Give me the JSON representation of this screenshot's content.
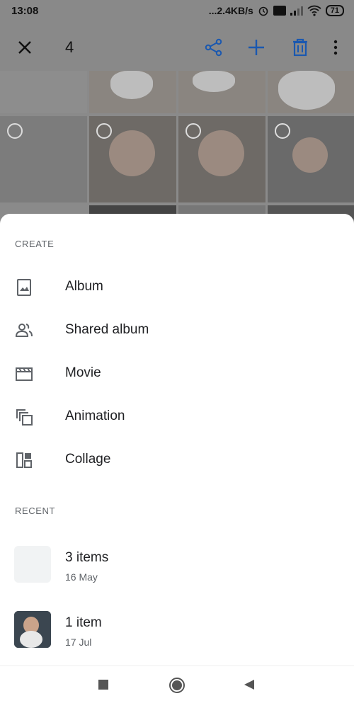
{
  "status_bar": {
    "time": "13:08",
    "network_speed": "...2.4KB/s",
    "battery": "71"
  },
  "top_bar": {
    "selected_count": "4",
    "accent_color": "#1a73e8"
  },
  "sheet": {
    "create_label": "CREATE",
    "create_items": [
      {
        "label": "Album",
        "icon": "album-icon"
      },
      {
        "label": "Shared album",
        "icon": "shared-album-icon"
      },
      {
        "label": "Movie",
        "icon": "movie-icon"
      },
      {
        "label": "Animation",
        "icon": "animation-icon"
      },
      {
        "label": "Collage",
        "icon": "collage-icon"
      }
    ],
    "recent_label": "RECENT",
    "recent_items": [
      {
        "title": "3 items",
        "date": "16 May"
      },
      {
        "title": "1 item",
        "date": "17 Jul"
      }
    ]
  }
}
